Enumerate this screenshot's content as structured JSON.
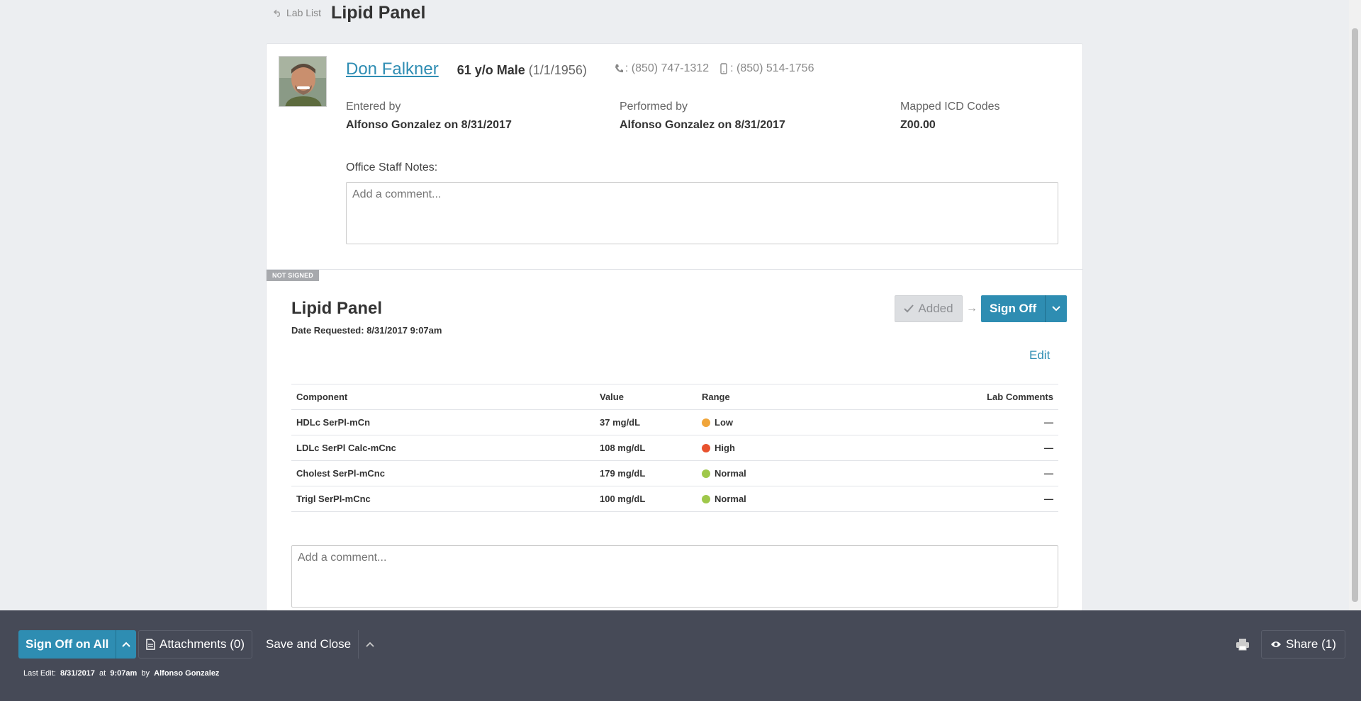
{
  "header": {
    "back_label": "Lab List",
    "title": "Lipid Panel"
  },
  "patient": {
    "name": "Don Falkner",
    "age_sex": "61 y/o Male",
    "dob": "(1/1/1956)",
    "home_phone": ": (850) 747-1312",
    "mobile_phone": ": (850) 514-1756"
  },
  "info": {
    "entered_label": "Entered by",
    "entered_value": "Alfonso Gonzalez on 8/31/2017",
    "performed_label": "Performed by",
    "performed_value": "Alfonso Gonzalez on 8/31/2017",
    "icd_label": "Mapped ICD Codes",
    "icd_value": "Z00.00"
  },
  "notes": {
    "label": "Office Staff Notes:",
    "placeholder": "Add a comment..."
  },
  "lab": {
    "badge": "NOT SIGNED",
    "title": "Lipid Panel",
    "date_requested": "Date Requested: 8/31/2017 9:07am",
    "added_label": "Added",
    "signoff_label": "Sign Off",
    "edit_label": "Edit",
    "columns": {
      "component": "Component",
      "value": "Value",
      "range": "Range",
      "comments": "Lab Comments"
    },
    "rows": [
      {
        "component": "HDLc SerPl-mCn",
        "value": "37 mg/dL",
        "range": "Low",
        "range_color": "#f0a53a",
        "comments": "—"
      },
      {
        "component": "LDLc SerPl Calc-mCnc",
        "value": "108 mg/dL",
        "range": "High",
        "range_color": "#e8522e",
        "comments": "—"
      },
      {
        "component": "Cholest SerPl-mCnc",
        "value": "179 mg/dL",
        "range": "Normal",
        "range_color": "#9fc84a",
        "comments": "—"
      },
      {
        "component": "Trigl SerPl-mCnc",
        "value": "100 mg/dL",
        "range": "Normal",
        "range_color": "#9fc84a",
        "comments": "—"
      }
    ],
    "comment_placeholder": "Add a comment..."
  },
  "footer": {
    "signoff_all": "Sign Off on All",
    "attachments": "Attachments (0)",
    "save_close": "Save and Close",
    "share": "Share (1)",
    "last_edit_prefix": "Last Edit:",
    "last_edit_date": "8/31/2017",
    "last_edit_at": "at",
    "last_edit_time": "9:07am",
    "last_edit_by": "by",
    "last_edit_user": "Alfonso Gonzalez"
  },
  "colors": {
    "accent": "#2e8db2",
    "footer_bg": "#464a57",
    "page_bg": "#eceef1"
  }
}
